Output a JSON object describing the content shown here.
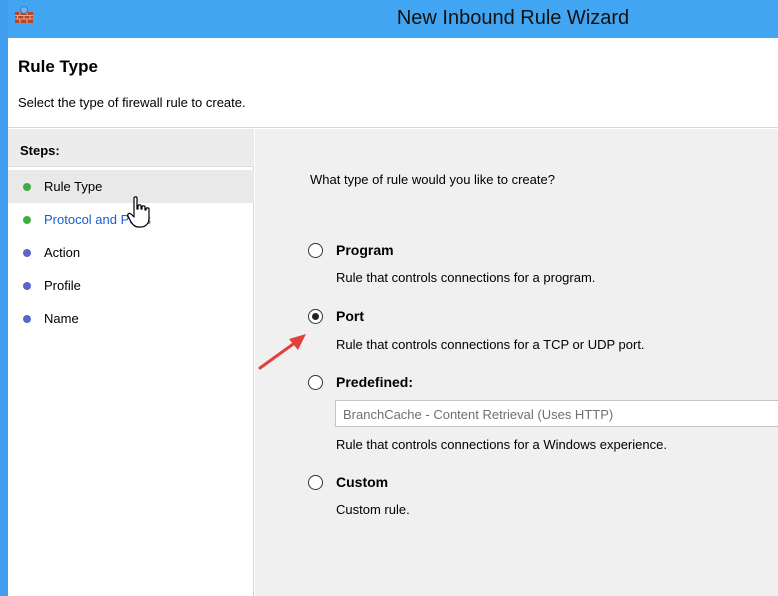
{
  "window": {
    "title": "New Inbound Rule Wizard",
    "accent_color": "#3f9ef0",
    "icon": "firewall-icon"
  },
  "header": {
    "title": "Rule Type",
    "subtitle": "Select the type of firewall rule to create."
  },
  "steps": {
    "header": "Steps:",
    "items": [
      {
        "label": "Rule Type",
        "status_color": "#3fae3f",
        "active": true
      },
      {
        "label": "Protocol and Ports",
        "status_color": "#3fae3f",
        "link": true
      },
      {
        "label": "Action",
        "status_color": "#5a66c8"
      },
      {
        "label": "Profile",
        "status_color": "#5a66c8"
      },
      {
        "label": "Name",
        "status_color": "#5a66c8"
      }
    ]
  },
  "content": {
    "question": "What type of rule would you like to create?",
    "options": [
      {
        "label": "Program",
        "description": "Rule that controls connections for a program.",
        "selected": false
      },
      {
        "label": "Port",
        "description": "Rule that controls connections for a TCP or UDP port.",
        "selected": true
      },
      {
        "label": "Predefined:",
        "description": "Rule that controls connections for a Windows experience.",
        "selected": false
      },
      {
        "label": "Custom",
        "description": "Custom rule.",
        "selected": false
      }
    ],
    "predefined_select": {
      "value": "BranchCache - Content Retrieval (Uses HTTP)"
    }
  }
}
